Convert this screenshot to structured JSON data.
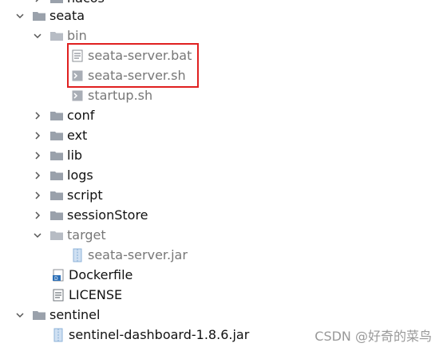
{
  "tree": {
    "partial_top": "nacos",
    "seata": "seata",
    "bin": "bin",
    "bin_files": [
      "seata-server.bat",
      "seata-server.sh",
      "startup.sh"
    ],
    "folders": [
      "conf",
      "ext",
      "lib",
      "logs",
      "script",
      "sessionStore"
    ],
    "target": "target",
    "target_files": [
      "seata-server.jar"
    ],
    "root_files": [
      "Dockerfile",
      "LICENSE"
    ],
    "sentinel": "sentinel",
    "sentinel_files": [
      "sentinel-dashboard-1.8.6.jar"
    ]
  },
  "watermark": "CSDN @好奇的菜鸟",
  "colors": {
    "folder": "#9aa1ab",
    "folder_dark": "#7e8590",
    "highlight": "#e02020",
    "jar": "#8fb3d9"
  }
}
